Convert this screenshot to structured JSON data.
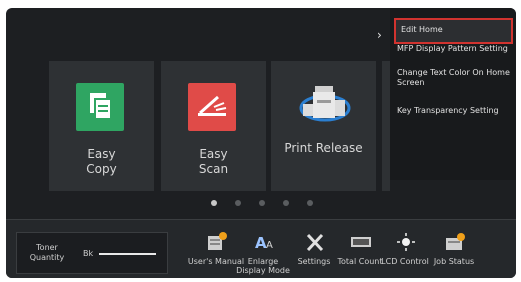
{
  "home": {
    "tiles": [
      {
        "label_line1": "Easy",
        "label_line2": "Copy"
      },
      {
        "label_line1": "Easy",
        "label_line2": "Scan"
      },
      {
        "label_line1": "Print Release",
        "label_line2": ""
      }
    ],
    "page_indicator": {
      "pages": 5,
      "active": 1
    }
  },
  "status_bar": {
    "toner_label": "Toner Quantity",
    "toner_color": "Bk",
    "toner_level": 0.95
  },
  "shortcuts": [
    {
      "label": "User's Manual",
      "icon": "manual-icon"
    },
    {
      "label": "Enlarge Display Mode",
      "icon": "enlarge-text-icon"
    },
    {
      "label": "Settings",
      "icon": "settings-tools-icon"
    },
    {
      "label": "Total Count",
      "icon": "counter-icon"
    },
    {
      "label": "LCD Control",
      "icon": "brightness-icon"
    },
    {
      "label": "Job Status",
      "icon": "job-status-icon"
    }
  ],
  "side_menu": {
    "items": [
      {
        "label": "Edit Home"
      },
      {
        "label": "MFP Display Pattern Setting"
      },
      {
        "label": "Change Text Color On Home Screen"
      },
      {
        "label": "Key Transparency Setting"
      }
    ]
  },
  "colors": {
    "background": "#1d1f22",
    "tile": "#2e3134",
    "easy_copy": "#2fa562",
    "easy_scan": "#e04b48",
    "highlight_border": "#d1332f"
  }
}
